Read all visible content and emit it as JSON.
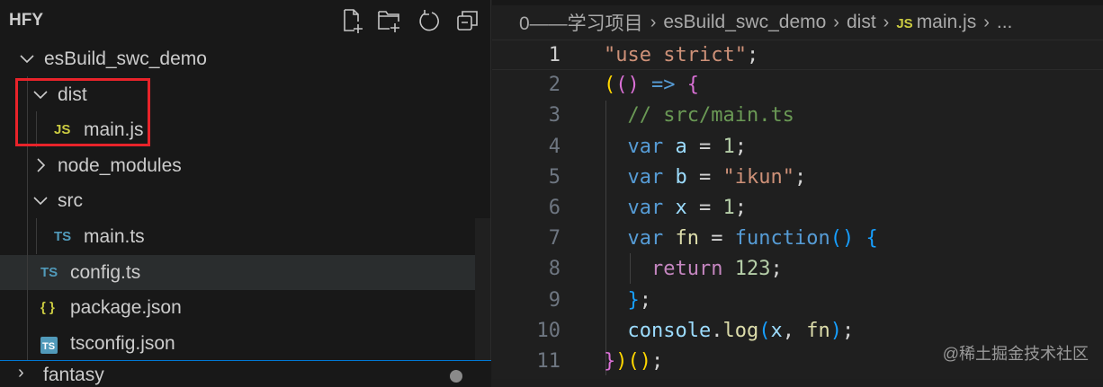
{
  "sidebar": {
    "title": "HFY",
    "actions": [
      "new-file",
      "new-folder",
      "refresh",
      "collapse-all"
    ],
    "tree": [
      {
        "label": "esBuild_swc_demo",
        "type": "folder",
        "expanded": true,
        "depth": 0
      },
      {
        "label": "dist",
        "type": "folder",
        "expanded": true,
        "depth": 1
      },
      {
        "label": "main.js",
        "type": "js",
        "icon": "JS",
        "depth": 2
      },
      {
        "label": "node_modules",
        "type": "folder",
        "expanded": false,
        "depth": 1
      },
      {
        "label": "src",
        "type": "folder",
        "expanded": true,
        "depth": 1
      },
      {
        "label": "main.ts",
        "type": "ts",
        "icon": "TS",
        "depth": 2
      },
      {
        "label": "config.ts",
        "type": "ts",
        "icon": "TS",
        "depth": 1,
        "selected": true
      },
      {
        "label": "package.json",
        "type": "json",
        "icon": "{ }",
        "depth": 1
      },
      {
        "label": "tsconfig.json",
        "type": "tsconfig",
        "icon": "TS",
        "depth": 1
      }
    ],
    "next_folder": "fantasy"
  },
  "breadcrumb": {
    "parts": [
      "0——学习项目",
      "esBuild_swc_demo",
      "dist"
    ],
    "file_icon": "JS",
    "file": "main.js",
    "more": "..."
  },
  "code": {
    "current_line": 1,
    "lines": [
      [
        [
          "\"use strict\"",
          "str"
        ],
        [
          ";",
          "p"
        ]
      ],
      [
        [
          "(",
          "b1"
        ],
        [
          "(",
          "b2"
        ],
        [
          ")",
          "b2"
        ],
        [
          " ",
          "p"
        ],
        [
          "=>",
          "kw"
        ],
        [
          " ",
          "p"
        ],
        [
          "{",
          "b2"
        ]
      ],
      [
        [
          "  ",
          "p"
        ],
        [
          "// src/main.ts",
          "cm"
        ]
      ],
      [
        [
          "  ",
          "p"
        ],
        [
          "var",
          "kw"
        ],
        [
          " ",
          "p"
        ],
        [
          "a",
          "var"
        ],
        [
          " = ",
          "p"
        ],
        [
          "1",
          "num"
        ],
        [
          ";",
          "p"
        ]
      ],
      [
        [
          "  ",
          "p"
        ],
        [
          "var",
          "kw"
        ],
        [
          " ",
          "p"
        ],
        [
          "b",
          "var"
        ],
        [
          " = ",
          "p"
        ],
        [
          "\"ikun\"",
          "str"
        ],
        [
          ";",
          "p"
        ]
      ],
      [
        [
          "  ",
          "p"
        ],
        [
          "var",
          "kw"
        ],
        [
          " ",
          "p"
        ],
        [
          "x",
          "var"
        ],
        [
          " = ",
          "p"
        ],
        [
          "1",
          "num"
        ],
        [
          ";",
          "p"
        ]
      ],
      [
        [
          "  ",
          "p"
        ],
        [
          "var",
          "kw"
        ],
        [
          " ",
          "p"
        ],
        [
          "fn",
          "fnc"
        ],
        [
          " = ",
          "p"
        ],
        [
          "function",
          "kw"
        ],
        [
          "(",
          "b3"
        ],
        [
          ")",
          "b3"
        ],
        [
          " ",
          "p"
        ],
        [
          "{",
          "b3"
        ]
      ],
      [
        [
          "    ",
          "p"
        ],
        [
          "return",
          "ctl"
        ],
        [
          " ",
          "p"
        ],
        [
          "123",
          "num"
        ],
        [
          ";",
          "p"
        ]
      ],
      [
        [
          "  ",
          "p"
        ],
        [
          "}",
          "b3"
        ],
        [
          ";",
          "p"
        ]
      ],
      [
        [
          "  ",
          "p"
        ],
        [
          "console",
          "var"
        ],
        [
          ".",
          "p"
        ],
        [
          "log",
          "fnc"
        ],
        [
          "(",
          "b3"
        ],
        [
          "x",
          "var"
        ],
        [
          ", ",
          "p"
        ],
        [
          "fn",
          "fnc"
        ],
        [
          ")",
          "b3"
        ],
        [
          ";",
          "p"
        ]
      ],
      [
        [
          "}",
          "b2"
        ],
        [
          ")",
          "b1"
        ],
        [
          "(",
          "b1"
        ],
        [
          ")",
          "b1"
        ],
        [
          ";",
          "p"
        ]
      ]
    ]
  },
  "watermark": "@稀土掘金技术社区",
  "colors": {
    "highlight_box": "#e8232a",
    "focus_border": "#0078d4"
  }
}
